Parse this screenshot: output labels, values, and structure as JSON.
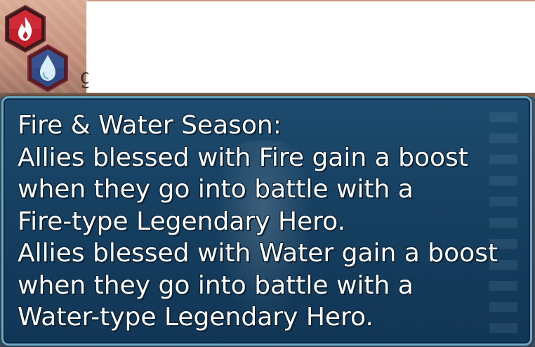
{
  "blessings": [
    {
      "icon": "fire-blessing-icon",
      "color": "#c21e2c"
    },
    {
      "icon": "water-blessing-icon",
      "color": "#2f4a86"
    }
  ],
  "partial_label": "g",
  "tooltip": {
    "lines": [
      "Fire & Water Season:",
      "Allies blessed with Fire gain a boost",
      "when they go into battle with a",
      "Fire-type Legendary Hero.",
      "Allies blessed with Water gain a boost",
      "when they go into battle with a",
      "Water-type Legendary Hero."
    ]
  },
  "colors": {
    "tooltip_bg": "#163f60",
    "tooltip_border": "#6aa9c4",
    "text": "#ffffff"
  }
}
